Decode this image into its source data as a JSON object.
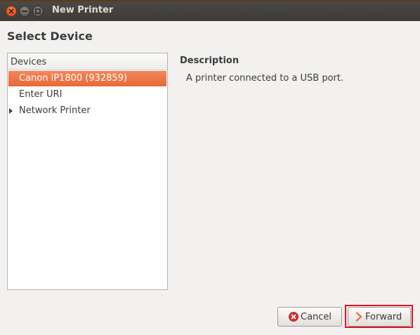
{
  "window": {
    "title": "New Printer"
  },
  "page": {
    "title": "Select Device"
  },
  "devices": {
    "header": "Devices",
    "items": [
      {
        "label": "Canon iP1800 (932859)",
        "selected": true,
        "expandable": false
      },
      {
        "label": "Enter URI",
        "selected": false,
        "expandable": false
      },
      {
        "label": "Network Printer",
        "selected": false,
        "expandable": true
      }
    ]
  },
  "description": {
    "heading": "Description",
    "text": "A printer connected to a USB port."
  },
  "buttons": {
    "cancel_label": "Cancel",
    "forward_label": "Forward"
  },
  "icons": {
    "close": "close-icon",
    "minimize": "minimize-icon",
    "maximize": "maximize-icon",
    "cancel": "cancel-circle-icon",
    "forward": "chevron-right-icon",
    "expander": "triangle-right-icon"
  },
  "colors": {
    "accent": "#e86a37",
    "titlebar": "#3c3b37",
    "highlight_border": "#e0141e",
    "background": "#f2f1f0"
  }
}
